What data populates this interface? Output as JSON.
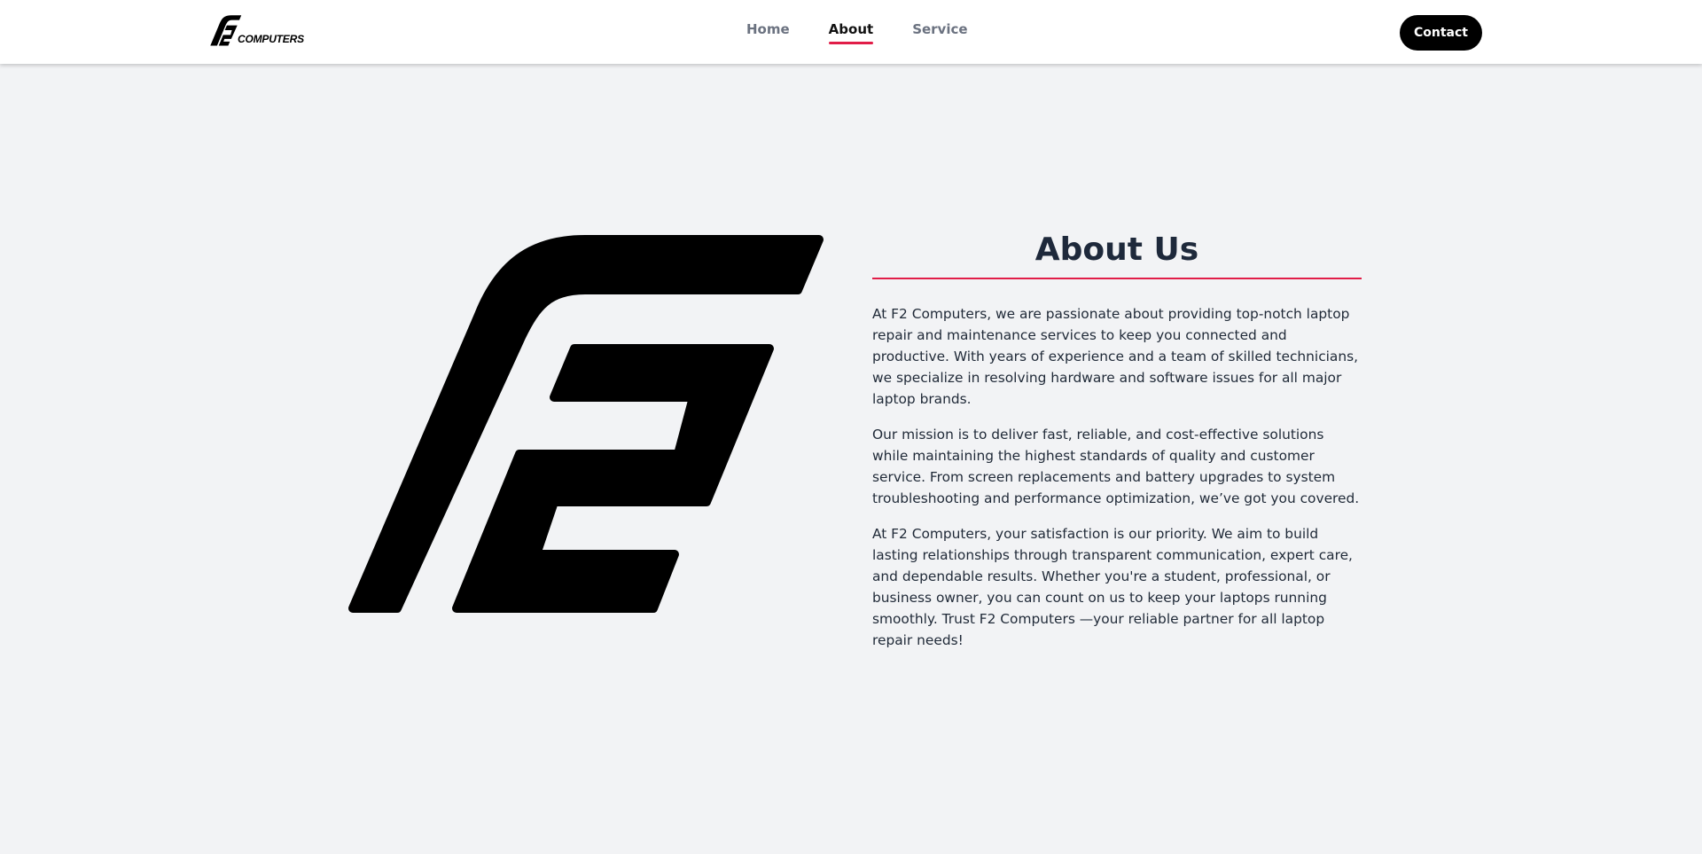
{
  "header": {
    "logo_text": "COMPUTERS",
    "nav": [
      {
        "label": "Home",
        "active": false
      },
      {
        "label": "About",
        "active": true
      },
      {
        "label": "Service",
        "active": false
      }
    ],
    "contact_label": "Contact"
  },
  "about": {
    "title": "About Us",
    "paragraphs": [
      "At F2 Computers, we are passionate about providing top-notch laptop repair and maintenance services to keep you connected and productive. With years of experience and a team of skilled technicians, we specialize in resolving hardware and software issues for all major laptop brands.",
      "Our mission is to deliver fast, reliable, and cost-effective solutions while maintaining the highest standards of quality and customer service. From screen replacements and battery upgrades to system troubleshooting and performance optimization, we’ve got you covered.",
      "At F2 Computers, your satisfaction is our priority. We aim to build lasting relationships through transparent communication, expert care, and dependable results. Whether you're a student, professional, or business owner, you can count on us to keep your laptops running smoothly. Trust F2 Computers —your reliable partner for all laptop repair needs!"
    ]
  },
  "colors": {
    "accent": "#e11d48",
    "background": "#f2f3f5",
    "heading": "#1e293b",
    "button": "#000000"
  },
  "icons": {
    "logo": "f2-logo-icon",
    "hero": "f2-monogram-icon"
  }
}
